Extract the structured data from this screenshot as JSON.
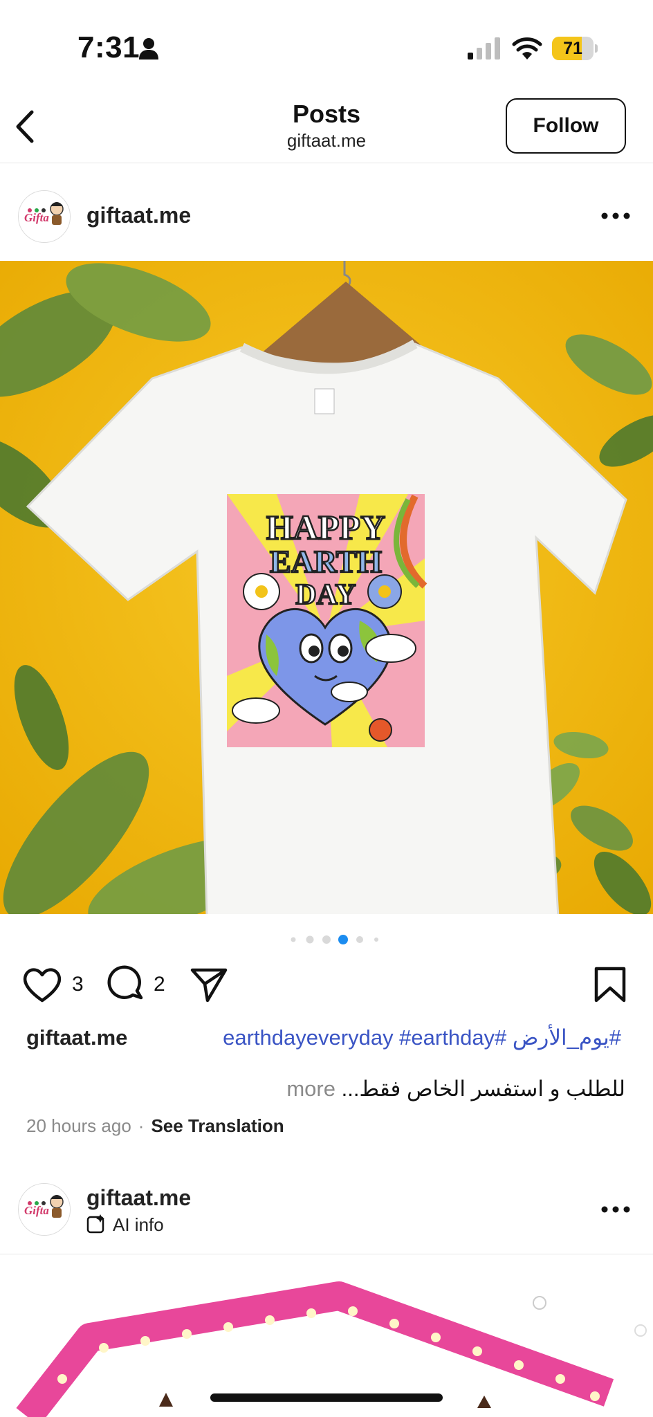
{
  "status_bar": {
    "time": "7:31",
    "battery_level": "71",
    "battery_fraction": 0.71,
    "icons": [
      "person-icon",
      "signal-icon",
      "wifi-icon",
      "battery-icon"
    ]
  },
  "header": {
    "title": "Posts",
    "subtitle": "giftaat.me",
    "follow_label": "Follow",
    "icons": [
      "back-icon"
    ]
  },
  "post": {
    "username": "giftaat.me",
    "carousel": {
      "count": 6,
      "active": 4
    },
    "like_count": "3",
    "comment_count": "2",
    "caption_user": "giftaat.me",
    "caption_tags": "earthdayeveryday #earthday# يوم_الأرض#",
    "caption_line2": "للطلب و استفسر الخاص فقط...",
    "more_label": "more",
    "time_ago": "20 hours ago",
    "see_translation": "See Translation",
    "shirt_text": [
      "HAPPY",
      "EARTH",
      "DAY"
    ],
    "icons": [
      "more-icon",
      "heart-icon",
      "comment-icon",
      "share-icon",
      "bookmark-icon"
    ]
  },
  "post2": {
    "username": "giftaat.me",
    "ai_label": "AI info",
    "icons": [
      "ai-info-icon",
      "more-icon"
    ]
  },
  "colors": {
    "link_blue": "#3a54c4",
    "dot_active": "#1b8cf0",
    "battery_yellow": "#f4c51a",
    "image_background": "#f2b90d"
  }
}
